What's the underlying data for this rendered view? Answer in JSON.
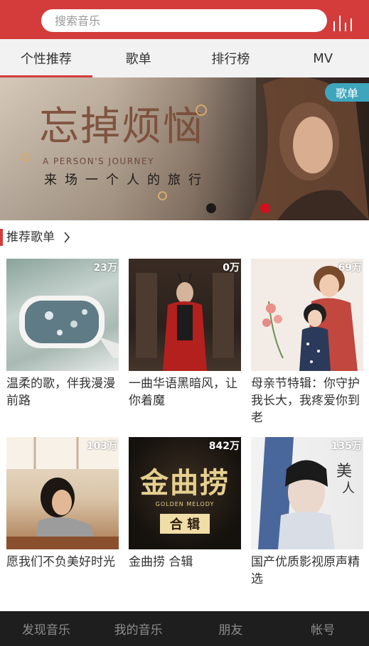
{
  "search": {
    "placeholder": "搜索音乐"
  },
  "tabs": [
    {
      "label": "个性推荐",
      "active": true
    },
    {
      "label": "歌单"
    },
    {
      "label": "排行榜"
    },
    {
      "label": "MV"
    }
  ],
  "banner": {
    "title": "忘掉烦恼",
    "subtitle_en": "A PERSON'S JOURNEY",
    "subtitle": "来场一个人的旅行",
    "tag": "歌单"
  },
  "section": {
    "title": "推荐歌单"
  },
  "playlists": [
    {
      "count": "23万",
      "title": "温柔的歌，伴我漫漫前路"
    },
    {
      "count": "0万",
      "title": "一曲华语黑暗风，让你着魔"
    },
    {
      "count": "69万",
      "title": "母亲节特辑：你守护我长大，我疼爱你到老"
    },
    {
      "count": "103万",
      "title": "愿我们不负美好时光"
    },
    {
      "count": "842万",
      "title": "金曲捞 合辑",
      "art_text": "金曲捞",
      "art_en": "GOLDEN MELODY",
      "art_sub": "合 辑"
    },
    {
      "count": "135万",
      "title": "国产优质影视原声精选"
    }
  ],
  "bottom_nav": [
    {
      "label": "发现音乐"
    },
    {
      "label": "我的音乐"
    },
    {
      "label": "朋友"
    },
    {
      "label": "帐号"
    }
  ],
  "colors": {
    "brand": "#d43c3c",
    "tag": "#3ea5bd",
    "nav_bg": "#1e1e1e"
  }
}
